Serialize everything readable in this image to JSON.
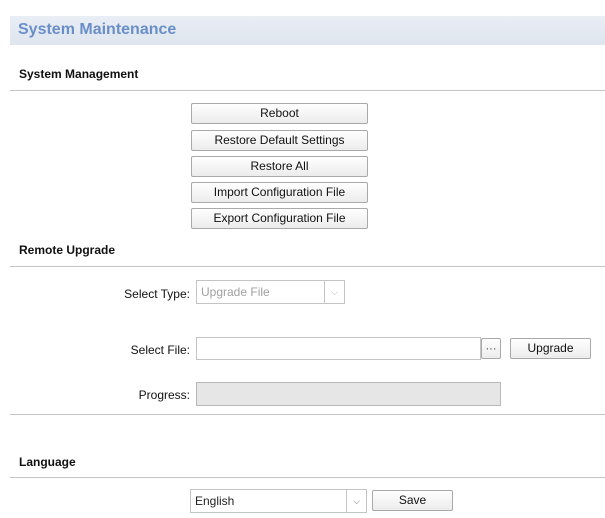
{
  "header": {
    "title": "System Maintenance"
  },
  "system_management": {
    "title": "System Management",
    "buttons": [
      {
        "label": "Reboot"
      },
      {
        "label": "Restore Default Settings"
      },
      {
        "label": "Restore All"
      },
      {
        "label": "Import Configuration File"
      },
      {
        "label": "Export Configuration File"
      }
    ]
  },
  "remote_upgrade": {
    "title": "Remote Upgrade",
    "select_type": {
      "label": "Select Type:",
      "value": "Upgrade File",
      "disabled": true
    },
    "select_file": {
      "label": "Select File:",
      "value": "",
      "browse_label": "···",
      "upgrade_label": "Upgrade"
    },
    "progress": {
      "label": "Progress:",
      "percent": 0
    }
  },
  "language": {
    "title": "Language",
    "selected": "English",
    "save_label": "Save"
  },
  "icons": {
    "dropdown_arrow": "chevron-down-icon",
    "browse": "ellipsis-icon"
  }
}
